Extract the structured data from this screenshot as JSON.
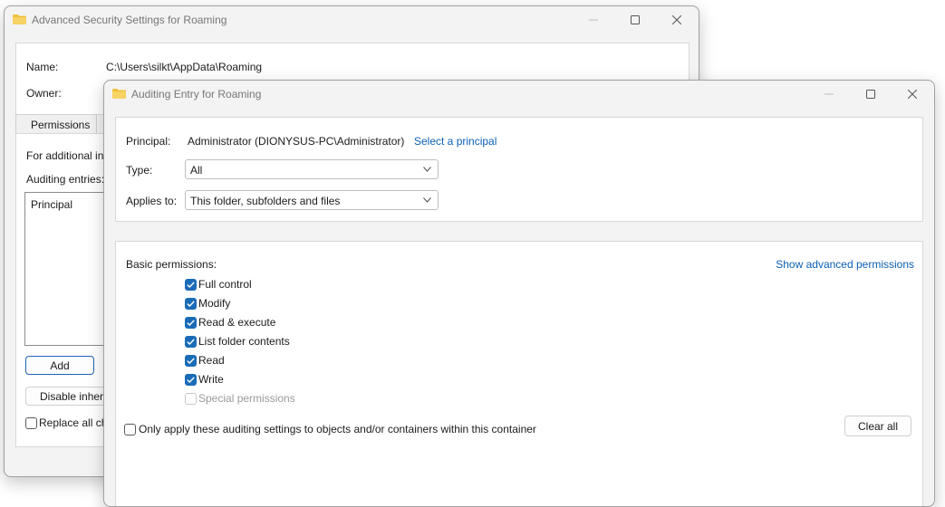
{
  "back_window": {
    "title": "Advanced Security Settings for Roaming",
    "name_label": "Name:",
    "name_value": "C:\\Users\\silkt\\AppData\\Roaming",
    "owner_label": "Owner:",
    "tab_permissions": "Permissions",
    "additional_info": "For additional in",
    "auditing_entries_label": "Auditing entries:",
    "principal_header": "Principal",
    "add_label": "Add",
    "disable_inheritance_label": "Disable inheri",
    "replace_all_label": "Replace all ch"
  },
  "front_window": {
    "title": "Auditing Entry for Roaming",
    "principal_label": "Principal:",
    "principal_value": "Administrator (DIONYSUS-PC\\Administrator)",
    "select_principal_link": "Select a principal",
    "type_label": "Type:",
    "type_value": "All",
    "applies_label": "Applies to:",
    "applies_value": "This folder, subfolders and files",
    "basic_permissions_label": "Basic permissions:",
    "show_advanced_link": "Show advanced permissions",
    "permissions": [
      {
        "label": "Full control",
        "state": "checked"
      },
      {
        "label": "Modify",
        "state": "checked"
      },
      {
        "label": "Read & execute",
        "state": "checked"
      },
      {
        "label": "List folder contents",
        "state": "checked"
      },
      {
        "label": "Read",
        "state": "checked"
      },
      {
        "label": "Write",
        "state": "checked"
      },
      {
        "label": "Special permissions",
        "state": "disabled"
      }
    ],
    "only_apply_label": "Only apply these auditing settings to objects and/or containers within this container",
    "clear_all_label": "Clear all"
  },
  "colors": {
    "accent": "#1a6cb7",
    "link": "#0a5fb4",
    "folder": "#f0c03c"
  },
  "icons": [
    "folder-icon",
    "minimize-icon",
    "maximize-icon",
    "close-icon",
    "chevron-down-icon",
    "checkmark-icon"
  ]
}
